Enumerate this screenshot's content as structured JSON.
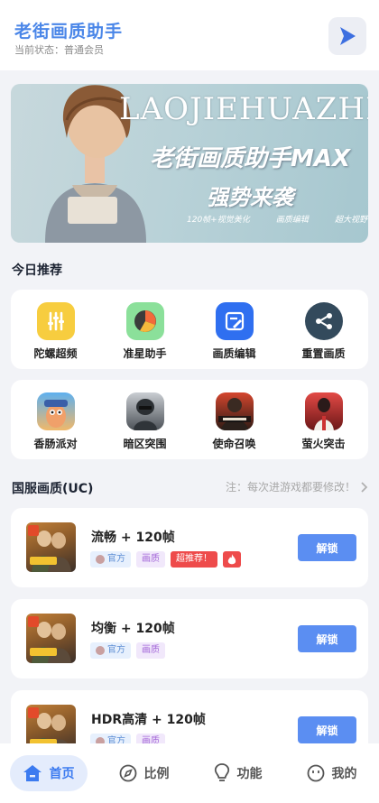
{
  "header": {
    "title": "老街画质助手",
    "status": "当前状态：普通会员"
  },
  "banner": {
    "english": "LAOJIEHUAZHI",
    "title": "老街画质助手MAX",
    "subtitle": "强势来袭",
    "tags": [
      "120帧+视觉美化",
      "画质编辑",
      "超大视野"
    ]
  },
  "today": {
    "title": "今日推荐",
    "tools": [
      {
        "label": "陀螺超频",
        "icon": "sliders-icon"
      },
      {
        "label": "准星助手",
        "icon": "pie-chart-icon"
      },
      {
        "label": "画质编辑",
        "icon": "edit-icon"
      },
      {
        "label": "重置画质",
        "icon": "share-icon"
      }
    ],
    "games": [
      {
        "label": "香肠派对",
        "icon": "sausage-party-icon"
      },
      {
        "label": "暗区突围",
        "icon": "arena-breakout-icon"
      },
      {
        "label": "使命召唤",
        "icon": "call-of-duty-icon"
      },
      {
        "label": "萤火突击",
        "icon": "firefly-assault-icon"
      }
    ]
  },
  "uc_section": {
    "title": "国服画质(UC)",
    "note": "注：每次进游戏都要修改！",
    "items": [
      {
        "name": "流畅 + 120帧",
        "tag_official": "官方",
        "tag_quality": "画质",
        "tag_hot": "超推荐！",
        "button": "解锁"
      },
      {
        "name": "均衡 + 120帧",
        "tag_official": "官方",
        "tag_quality": "画质",
        "button": "解锁"
      },
      {
        "name": "HDR高清 + 120帧",
        "tag_official": "官方",
        "tag_quality": "画质",
        "button": "解锁"
      }
    ]
  },
  "tabbar": {
    "tabs": [
      {
        "label": "首页",
        "icon": "home-icon",
        "active": true
      },
      {
        "label": "比例",
        "icon": "compass-icon",
        "active": false
      },
      {
        "label": "功能",
        "icon": "lightbulb-icon",
        "active": false
      },
      {
        "label": "我的",
        "icon": "smile-icon",
        "active": false
      }
    ]
  },
  "colors": {
    "accent": "#4a86e8",
    "button": "#5b8ef2",
    "hot": "#ee4b4b"
  }
}
